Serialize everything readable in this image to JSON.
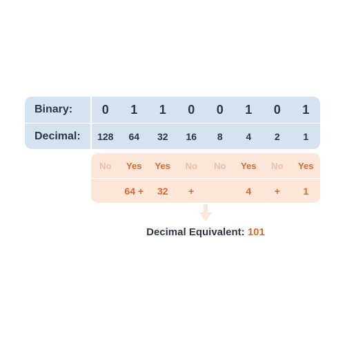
{
  "labels": {
    "binary": "Binary:",
    "decimal": "Decimal:",
    "result_prefix": "Decimal Equivalent: "
  },
  "binary_bits": [
    "0",
    "1",
    "1",
    "0",
    "0",
    "1",
    "0",
    "1"
  ],
  "place_values": [
    "128",
    "64",
    "32",
    "16",
    "8",
    "4",
    "2",
    "1"
  ],
  "flags": [
    "No",
    "Yes",
    "Yes",
    "No",
    "No",
    "Yes",
    "No",
    "Yes"
  ],
  "sum_cells": [
    "",
    "64 +",
    "32",
    "+",
    "",
    "4",
    "+",
    "1"
  ],
  "result_value": "101",
  "chart_data": {
    "type": "table",
    "title": "Binary to Decimal Conversion",
    "binary": "01100101",
    "bits": [
      0,
      1,
      1,
      0,
      0,
      1,
      0,
      1
    ],
    "place_values": [
      128,
      64,
      32,
      16,
      8,
      4,
      2,
      1
    ],
    "included": [
      false,
      true,
      true,
      false,
      false,
      true,
      false,
      true
    ],
    "addends": [
      64,
      32,
      4,
      1
    ],
    "decimal_equivalent": 101
  }
}
